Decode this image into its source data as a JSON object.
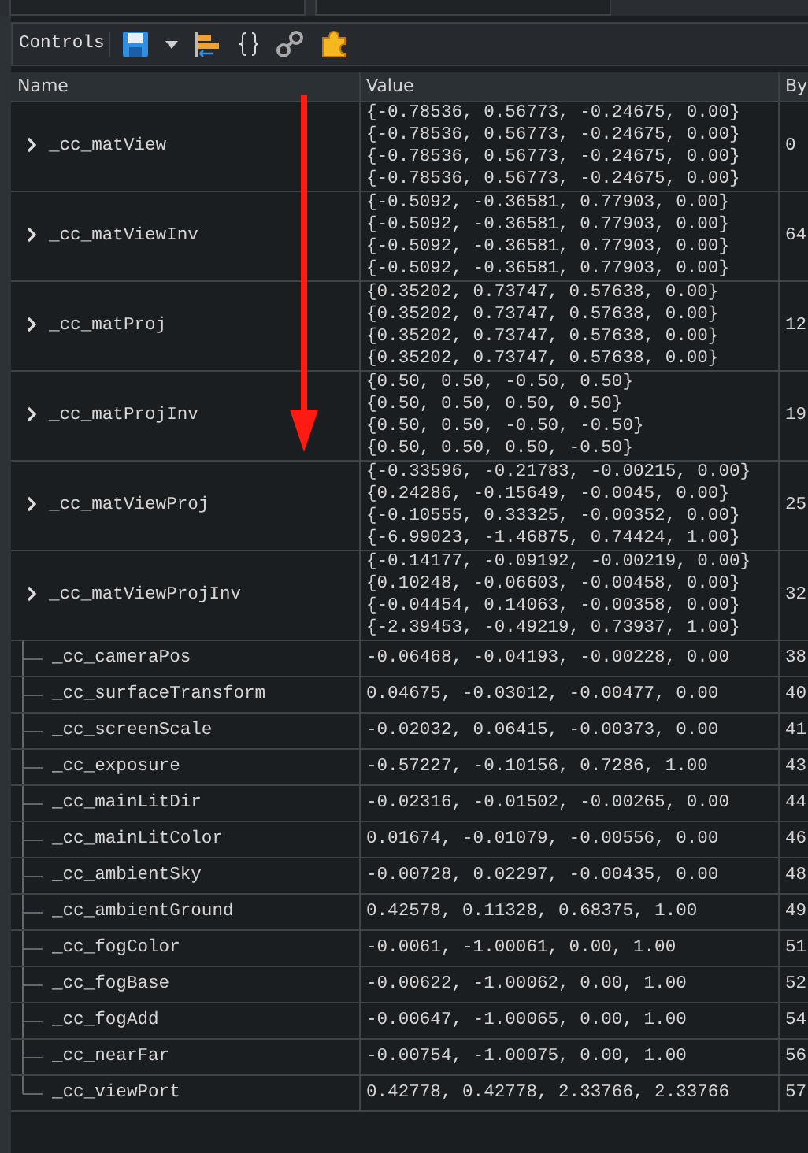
{
  "toolbar": {
    "label": "Controls"
  },
  "table": {
    "columns": [
      "Name",
      "Value",
      "By"
    ],
    "rows": [
      {
        "kind": "matrix",
        "name": "_cc_matView",
        "expanded": false,
        "value": [
          "{-0.78536, 0.56773, -0.24675, 0.00}",
          "{-0.78536, 0.56773, -0.24675, 0.00}",
          "{-0.78536, 0.56773, -0.24675, 0.00}",
          "{-0.78536, 0.56773, -0.24675, 0.00}"
        ],
        "bytes": "0"
      },
      {
        "kind": "matrix",
        "name": "_cc_matViewInv",
        "expanded": false,
        "value": [
          "{-0.5092, -0.36581, 0.77903, 0.00}",
          "{-0.5092, -0.36581, 0.77903, 0.00}",
          "{-0.5092, -0.36581, 0.77903, 0.00}",
          "{-0.5092, -0.36581, 0.77903, 0.00}"
        ],
        "bytes": "64"
      },
      {
        "kind": "matrix",
        "name": "_cc_matProj",
        "expanded": false,
        "value": [
          "{0.35202, 0.73747, 0.57638, 0.00}",
          "{0.35202, 0.73747, 0.57638, 0.00}",
          "{0.35202, 0.73747, 0.57638, 0.00}",
          "{0.35202, 0.73747, 0.57638, 0.00}"
        ],
        "bytes": "12"
      },
      {
        "kind": "matrix",
        "name": "_cc_matProjInv",
        "expanded": false,
        "value": [
          "{0.50, 0.50, -0.50, 0.50}",
          "{0.50, 0.50, 0.50, 0.50}",
          "{0.50, 0.50, -0.50, -0.50}",
          "{0.50, 0.50, 0.50, -0.50}"
        ],
        "bytes": "19"
      },
      {
        "kind": "matrix",
        "name": "_cc_matViewProj",
        "expanded": false,
        "value": [
          "{-0.33596, -0.21783, -0.00215, 0.00}",
          "{0.24286, -0.15649, -0.0045, 0.00}",
          "{-0.10555, 0.33325, -0.00352, 0.00}",
          "{-6.99023, -1.46875, 0.74424, 1.00}"
        ],
        "bytes": "25"
      },
      {
        "kind": "matrix",
        "name": "_cc_matViewProjInv",
        "expanded": false,
        "value": [
          "{-0.14177, -0.09192, -0.00219, 0.00}",
          "{0.10248, -0.06603, -0.00458, 0.00}",
          "{-0.04454, 0.14063, -0.00358, 0.00}",
          "{-2.39453, -0.49219, 0.73937, 1.00}"
        ],
        "bytes": "32"
      },
      {
        "kind": "vector",
        "name": "_cc_cameraPos",
        "value": "-0.06468, -0.04193, -0.00228, 0.00",
        "bytes": "38"
      },
      {
        "kind": "vector",
        "name": "_cc_surfaceTransform",
        "value": "0.04675, -0.03012, -0.00477, 0.00",
        "bytes": "40"
      },
      {
        "kind": "vector",
        "name": "_cc_screenScale",
        "value": "-0.02032, 0.06415, -0.00373, 0.00",
        "bytes": "41"
      },
      {
        "kind": "vector",
        "name": "_cc_exposure",
        "value": "-0.57227, -0.10156, 0.7286, 1.00",
        "bytes": "43"
      },
      {
        "kind": "vector",
        "name": "_cc_mainLitDir",
        "value": "-0.02316, -0.01502, -0.00265, 0.00",
        "bytes": "44"
      },
      {
        "kind": "vector",
        "name": "_cc_mainLitColor",
        "value": "0.01674, -0.01079, -0.00556, 0.00",
        "bytes": "46"
      },
      {
        "kind": "vector",
        "name": "_cc_ambientSky",
        "value": "-0.00728, 0.02297, -0.00435, 0.00",
        "bytes": "48"
      },
      {
        "kind": "vector",
        "name": "_cc_ambientGround",
        "value": "0.42578, 0.11328, 0.68375, 1.00",
        "bytes": "49"
      },
      {
        "kind": "vector",
        "name": "_cc_fogColor",
        "value": "-0.0061, -1.00061, 0.00, 1.00",
        "bytes": "51"
      },
      {
        "kind": "vector",
        "name": "_cc_fogBase",
        "value": "-0.00622, -1.00062, 0.00, 1.00",
        "bytes": "52"
      },
      {
        "kind": "vector",
        "name": "_cc_fogAdd",
        "value": "-0.00647, -1.00065, 0.00, 1.00",
        "bytes": "54"
      },
      {
        "kind": "vector",
        "name": "_cc_nearFar",
        "value": "-0.00754, -1.00075, 0.00, 1.00",
        "bytes": "56"
      },
      {
        "kind": "vector",
        "name": "_cc_viewPort",
        "value": "0.42778, 0.42778, 2.33766, 2.33766",
        "bytes": "57"
      }
    ]
  }
}
